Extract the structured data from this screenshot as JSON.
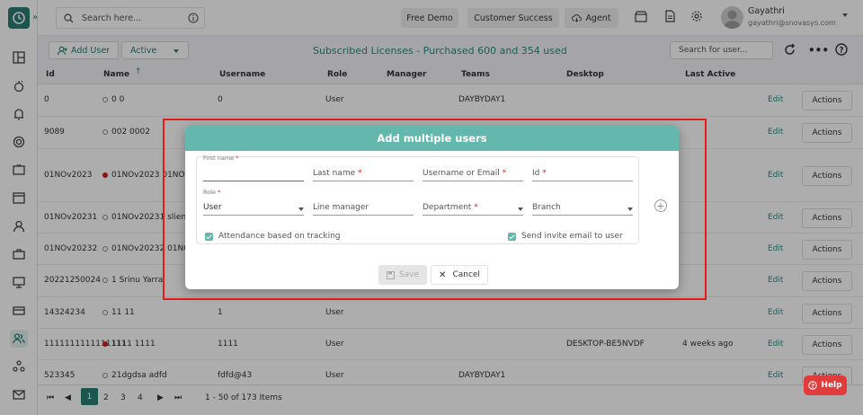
{
  "topbar": {
    "search_placeholder": "Search here...",
    "free_demo": "Free Demo",
    "customer_success": "Customer Success",
    "agent": "Agent",
    "user_name": "Gayathri",
    "user_email": "gayathri@snovasys.com"
  },
  "toolbar": {
    "add_user": "Add User",
    "status": "Active",
    "license_text": "Subscribed Licenses - Purchased 600 and 354 used",
    "search_placeholder": "Search for user..."
  },
  "columns": [
    "Id",
    "Name",
    "Username",
    "Role",
    "Manager",
    "Teams",
    "Desktop",
    "Last Active"
  ],
  "rows": [
    {
      "id": "0",
      "name": "0 0",
      "username": "0",
      "role": "User",
      "teams": "DAYBYDAY1",
      "desktop": "",
      "last_active": "",
      "status": "offline"
    },
    {
      "id": "9089",
      "name": "002 0002",
      "username": "",
      "role": "",
      "teams": "",
      "desktop": "",
      "last_active": "",
      "status": "offline"
    },
    {
      "id": "01NOv2023",
      "name": "01NOv2023 01NOv2",
      "username": "",
      "role": "",
      "teams": "",
      "desktop": "",
      "last_active": "",
      "status": "online"
    },
    {
      "id": "01NOv20231",
      "name": "01NOv20231 slien...",
      "username": "",
      "role": "",
      "teams": "",
      "desktop": "",
      "last_active": "",
      "status": "offline"
    },
    {
      "id": "01NOv20232",
      "name": "01NOv20232 01NO",
      "username": "",
      "role": "",
      "teams": "",
      "desktop": "",
      "last_active": "",
      "status": "offline"
    },
    {
      "id": "20221250024",
      "name": "1 Srinu Yarra",
      "username": "",
      "role": "",
      "teams": "",
      "desktop": "",
      "last_active": "",
      "status": "offline"
    },
    {
      "id": "14324234",
      "name": "11 11",
      "username": "1",
      "role": "User",
      "teams": "",
      "desktop": "",
      "last_active": "",
      "status": "offline"
    },
    {
      "id": "1111111111111111",
      "name": "1111 1111",
      "username": "1111",
      "role": "User",
      "teams": "",
      "desktop": "DESKTOP-BE5NVDF",
      "last_active": "4 weeks ago",
      "status": "online"
    },
    {
      "id": "523345",
      "name": "21dgdsa adfd",
      "username": "fdfd@43",
      "role": "User",
      "teams": "DAYBYDAY1",
      "desktop": "",
      "last_active": "",
      "status": "offline"
    }
  ],
  "row_edit": "Edit",
  "row_actions": "Actions",
  "pagination": {
    "pages": [
      "1",
      "2",
      "3",
      "4"
    ],
    "summary": "1 - 50 of 173 Items"
  },
  "dialog": {
    "title": "Add multiple users",
    "first_name_label": "First name",
    "last_name": "Last name",
    "username_email": "Username or Email",
    "id_label": "Id",
    "role_label": "Role",
    "role_value": "User",
    "line_manager": "Line manager",
    "department": "Department",
    "branch": "Branch",
    "attendance": "Attendance based on tracking",
    "send_invite": "Send invite email to user",
    "save": "Save",
    "cancel": "Cancel"
  },
  "help": "Help",
  "colors": {
    "accent": "#2a7d74",
    "dialog_header": "#63b7ad",
    "highlight": "#e31b1b",
    "help": "#e23b3b"
  }
}
